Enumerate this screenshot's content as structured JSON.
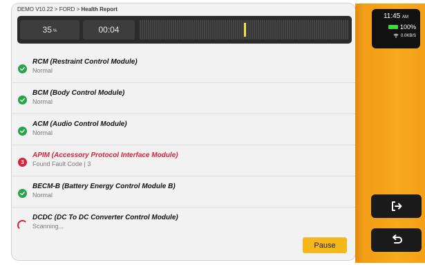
{
  "breadcrumb": {
    "path": "DEMO V10.22 > FORD > ",
    "current": "Health Report"
  },
  "progress": {
    "percent_value": "35",
    "percent_unit": "%",
    "elapsed": "00:04",
    "scan_position_fraction": 0.5
  },
  "modules": [
    {
      "status": "ok",
      "title": "RCM (Restraint Control Module)",
      "subtitle": "Normal"
    },
    {
      "status": "ok",
      "title": "BCM (Body Control Module)",
      "subtitle": "Normal"
    },
    {
      "status": "ok",
      "title": "ACM (Audio Control Module)",
      "subtitle": "Normal"
    },
    {
      "status": "fault",
      "badge": "3",
      "title": "APIM (Accessory Protocol Interface Module)",
      "subtitle": "Found Fault Code | 3"
    },
    {
      "status": "ok",
      "title": "BECM-B (Battery Energy Control Module B)",
      "subtitle": "Normal"
    },
    {
      "status": "scanning",
      "title": "DCDC (DC To DC Converter Control Module)",
      "subtitle": "Scanning..."
    }
  ],
  "actions": {
    "pause_label": "Pause"
  },
  "status_bar": {
    "time": "11:45",
    "ampm": "AM",
    "battery": "100%",
    "network": "0.0KB/S"
  },
  "icons": {
    "exit": "exit-icon",
    "back": "back-icon",
    "battery": "battery-icon",
    "wifi": "wifi-icon"
  },
  "colors": {
    "accent": "#f5b81c",
    "ok": "#27a34a",
    "fault": "#d4243a",
    "panel": "#f4a018"
  }
}
